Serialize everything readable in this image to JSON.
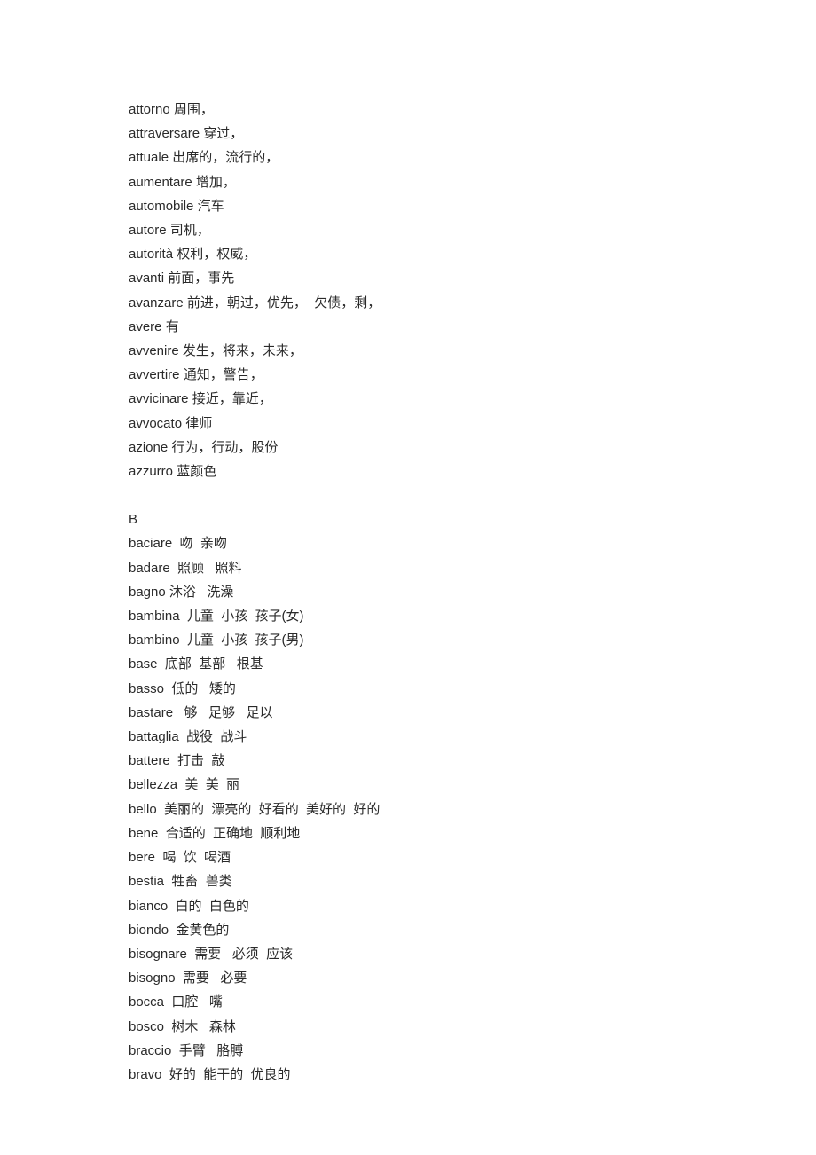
{
  "sections": [
    {
      "heading": null,
      "entries": [
        {
          "term": "attorno",
          "def": "周围，"
        },
        {
          "term": "attraversare",
          "def": "穿过，"
        },
        {
          "term": "attuale",
          "def": "出席的，流行的，"
        },
        {
          "term": "aumentare",
          "def": "增加，"
        },
        {
          "term": "automobile",
          "def": "汽车"
        },
        {
          "term": "autore",
          "def": "司机，"
        },
        {
          "term": "autorità",
          "def": "权利，权威，"
        },
        {
          "term": "avanti",
          "def": "前面，事先"
        },
        {
          "term": "avanzare",
          "def": "前进，朝过，优先，  欠债，剩，"
        },
        {
          "term": "avere",
          "def": "有"
        },
        {
          "term": "avvenire",
          "def": "发生，将来，未来，"
        },
        {
          "term": "avvertire",
          "def": "通知，警告，"
        },
        {
          "term": "avvicinare",
          "def": "接近，靠近，"
        },
        {
          "term": "avvocato",
          "def": "律师"
        },
        {
          "term": "azione",
          "def": "行为，行动，股份"
        },
        {
          "term": "azzurro",
          "def": "蓝颜色"
        }
      ]
    },
    {
      "heading": "B",
      "entries": [
        {
          "term": "baciare",
          "def": " 吻  亲吻"
        },
        {
          "term": "badare",
          "def": " 照顾   照料"
        },
        {
          "term": "bagno",
          "def": "沐浴   洗澡"
        },
        {
          "term": "bambina",
          "def": " 儿童  小孩  孩子(女)"
        },
        {
          "term": "bambino",
          "def": " 儿童  小孩  孩子(男)"
        },
        {
          "term": "base",
          "def": " 底部  基部   根基"
        },
        {
          "term": "basso",
          "def": " 低的   矮的"
        },
        {
          "term": "bastare",
          "def": "  够   足够   足以"
        },
        {
          "term": "battaglia",
          "def": " 战役  战斗"
        },
        {
          "term": "battere",
          "def": " 打击  敲"
        },
        {
          "term": "bellezza",
          "def": " 美  美  丽"
        },
        {
          "term": "bello",
          "def": " 美丽的  漂亮的  好看的  美好的  好的"
        },
        {
          "term": "bene",
          "def": " 合适的  正确地  顺利地"
        },
        {
          "term": "bere",
          "def": " 喝  饮  喝酒"
        },
        {
          "term": "bestia",
          "def": " 牲畜  兽类"
        },
        {
          "term": "bianco",
          "def": " 白的  白色的"
        },
        {
          "term": "biondo",
          "def": " 金黄色的"
        },
        {
          "term": "bisognare",
          "def": " 需要   必须  应该"
        },
        {
          "term": "bisogno",
          "def": " 需要   必要"
        },
        {
          "term": "bocca",
          "def": " 口腔   嘴"
        },
        {
          "term": "bosco",
          "def": " 树木   森林"
        },
        {
          "term": "braccio",
          "def": " 手臂   胳膊"
        },
        {
          "term": "bravo",
          "def": " 好的  能干的  优良的"
        }
      ]
    }
  ]
}
